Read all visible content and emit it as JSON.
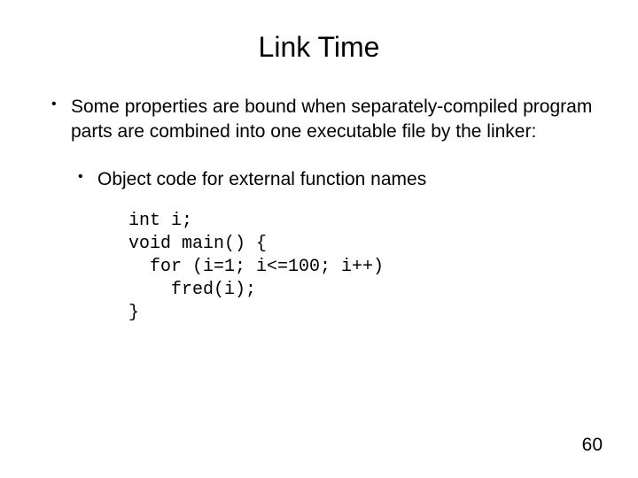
{
  "title": "Link Time",
  "bullets": {
    "main": "Some properties are bound when separately-compiled program parts are combined into one executable file by the linker:",
    "sub": "Object code for external function names"
  },
  "code": "int i;\nvoid main() {\n  for (i=1; i<=100; i++)\n    fred(i);\n}",
  "page_number": "60"
}
